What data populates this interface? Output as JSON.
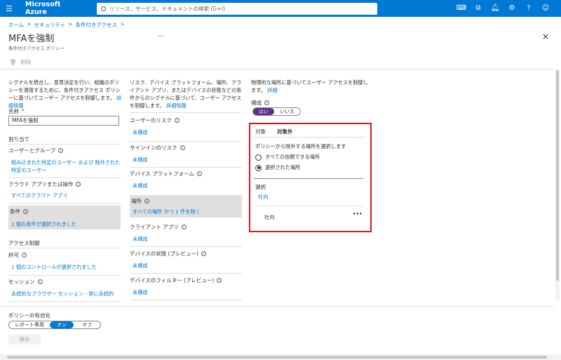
{
  "topbar": {
    "brand": "Microsoft Azure",
    "search_placeholder": "リソース、サービス、ドキュメントの検索 (G+/)",
    "icons": [
      "cloud-shell-icon",
      "directory-filter-icon",
      "bell-icon",
      "gear-icon",
      "help-icon",
      "feedback-icon"
    ]
  },
  "breadcrumb": [
    "ホーム",
    "セキュリティ",
    "条件付きアクセス"
  ],
  "header": {
    "title": "MFAを強制",
    "subtitle": "条件付きアクセス ポリシー",
    "ellipsis": "...",
    "close": "×",
    "delete_label": "削除"
  },
  "col1": {
    "description": "シグナルを統合し、意思決定を行い、組織のポリシーを適用するために、条件付きアクセス ポリシーに基づいてユーザー アクセスを制御します。",
    "description_link": "詳細情報",
    "name_label": "名前",
    "name_required": "*",
    "name_value": "MFAを強制",
    "assignments_heading": "割り当て",
    "users_label": "ユーザーとグループ",
    "users_value": "組み込まれた特定のユーザー および 除外された特定のユーザー",
    "apps_label": "クラウド アプリまたは操作",
    "apps_value": "すべてのクラウド アプリ",
    "conditions_label": "条件",
    "conditions_value": "1 個の条件が選択されました",
    "access_heading": "アクセス制御",
    "grant_label": "許可",
    "grant_value": "1 個のコントロールが選択されました",
    "session_label": "セッション",
    "session_value": "永続的なブラウザー セッション - 常に永続的"
  },
  "col2": {
    "description": "リスク、デバイス プラットフォーム、場所、クライアント アプリ、またはデバイスの状態などの条件からのシグナルに基づいて、ユーザー アクセスを制御します。",
    "description_link": "詳細情報",
    "items": [
      {
        "label": "ユーザーのリスク",
        "value": "未構成"
      },
      {
        "label": "サインインのリスク",
        "value": "未構成"
      },
      {
        "label": "デバイス プラットフォーム",
        "value": "未構成"
      },
      {
        "label": "場所",
        "value": "すべての場所 かつ 1 件を除く"
      },
      {
        "label": "クライアント アプリ",
        "value": "未構成"
      },
      {
        "label": "デバイスの状態 (プレビュー)",
        "value": "未構成"
      },
      {
        "label": "デバイスのフィルター (プレビュー)",
        "value": "未構成"
      }
    ]
  },
  "col3": {
    "description": "物理的な場所に基づいてユーザー アクセスを制御します。",
    "description_link": "詳細",
    "configure_label": "構成",
    "toggle_yes": "はい",
    "toggle_no": "いいえ",
    "tabs": [
      "対象",
      "対象外"
    ],
    "select_prompt": "ポリシーから除外する場所を選択します",
    "radio_all": "すべての信頼できる場所",
    "radio_selected": "選択された場所",
    "select_heading": "選択",
    "select_value": "社内",
    "location_item": "社内",
    "item_menu": "•••"
  },
  "footer": {
    "enable_label": "ポリシーの有効化",
    "options": [
      "レポート専用",
      "オン",
      "オフ"
    ],
    "save_label": "保存"
  },
  "colors": {
    "accent": "#0078d4",
    "toggle_yes": "#5c2d91",
    "highlight_border": "#d9181e"
  }
}
